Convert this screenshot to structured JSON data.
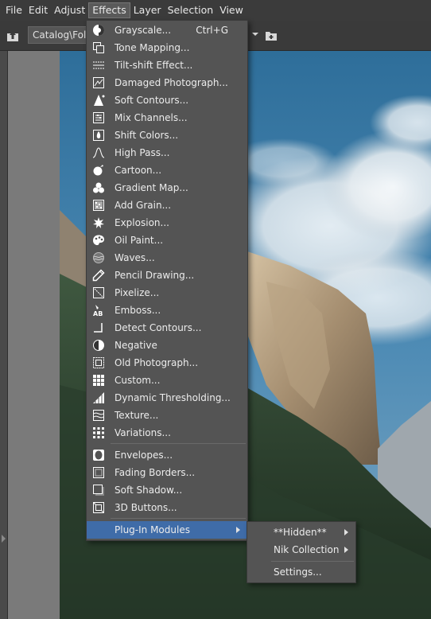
{
  "menubar": {
    "items": [
      "File",
      "Edit",
      "Adjust",
      "Effects",
      "Layer",
      "Selection",
      "View"
    ],
    "active": "Effects"
  },
  "toolbar": {
    "path": "Catalog\\Fold"
  },
  "effects_menu": {
    "items": [
      {
        "label": "Grayscale...",
        "shortcut": "Ctrl+G",
        "icon": "grayscale-icon"
      },
      {
        "label": "Tone Mapping...",
        "icon": "tone-mapping-icon"
      },
      {
        "label": "Tilt-shift Effect...",
        "icon": "tilt-shift-icon"
      },
      {
        "label": "Damaged Photograph...",
        "icon": "damaged-photo-icon"
      },
      {
        "label": "Soft Contours...",
        "icon": "soft-contours-icon"
      },
      {
        "label": "Mix Channels...",
        "icon": "mix-channels-icon"
      },
      {
        "label": "Shift Colors...",
        "icon": "shift-colors-icon"
      },
      {
        "label": "High Pass...",
        "icon": "high-pass-icon"
      },
      {
        "label": "Cartoon...",
        "icon": "cartoon-icon"
      },
      {
        "label": "Gradient Map...",
        "icon": "gradient-map-icon"
      },
      {
        "label": "Add Grain...",
        "icon": "add-grain-icon"
      },
      {
        "label": "Explosion...",
        "icon": "explosion-icon"
      },
      {
        "label": "Oil Paint...",
        "icon": "oil-paint-icon"
      },
      {
        "label": "Waves...",
        "icon": "waves-icon"
      },
      {
        "label": "Pencil Drawing...",
        "icon": "pencil-icon"
      },
      {
        "label": "Pixelize...",
        "icon": "pixelize-icon"
      },
      {
        "label": "Emboss...",
        "icon": "emboss-icon"
      },
      {
        "label": "Detect Contours...",
        "icon": "detect-contours-icon"
      },
      {
        "label": "Negative",
        "icon": "negative-icon"
      },
      {
        "label": "Old Photograph...",
        "icon": "old-photo-icon"
      },
      {
        "label": "Custom...",
        "icon": "custom-grid-icon"
      },
      {
        "label": "Dynamic Thresholding...",
        "icon": "dynamic-threshold-icon"
      },
      {
        "label": "Texture...",
        "icon": "texture-icon"
      },
      {
        "label": "Variations...",
        "icon": "variations-icon"
      }
    ],
    "border_items": [
      {
        "label": "Envelopes...",
        "icon": "envelopes-icon"
      },
      {
        "label": "Fading Borders...",
        "icon": "fading-borders-icon"
      },
      {
        "label": "Soft Shadow...",
        "icon": "soft-shadow-icon"
      },
      {
        "label": "3D Buttons...",
        "icon": "3d-buttons-icon"
      }
    ],
    "plugin": {
      "label": "Plug-In Modules"
    }
  },
  "submenu": {
    "items": [
      {
        "label": "**Hidden**",
        "has_arrow": true
      },
      {
        "label": "Nik Collection",
        "has_arrow": true
      },
      {
        "label": "Settings...",
        "has_arrow": false
      }
    ]
  },
  "colors": {
    "highlight": "#3f6ca8",
    "menu_bg": "#545454"
  }
}
